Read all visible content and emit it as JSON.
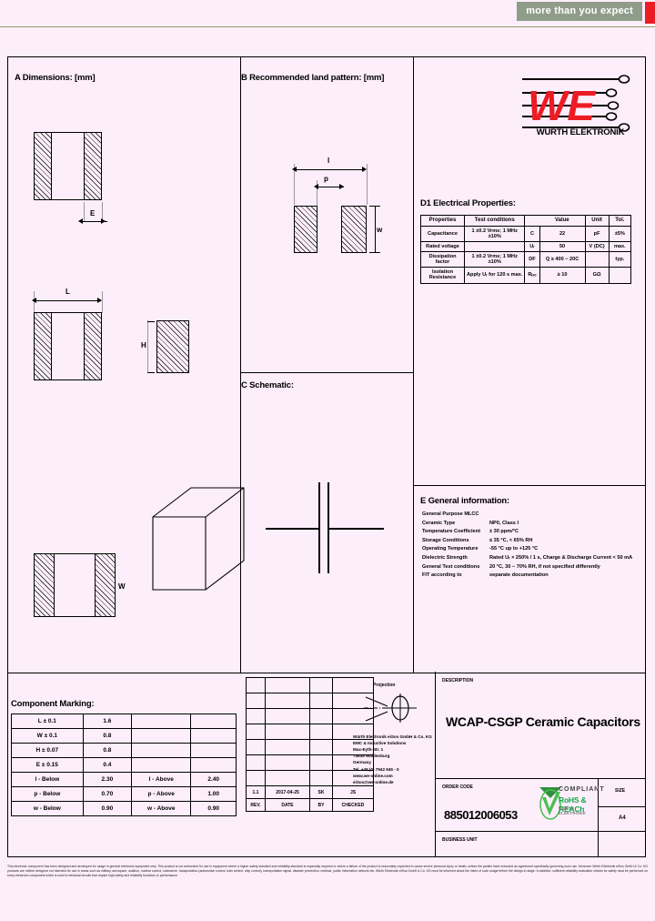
{
  "banner": {
    "tagline": "more than you expect"
  },
  "sections": {
    "a": "A Dimensions: [mm]",
    "b": "B Recommended land pattern: [mm]",
    "c": "C Schematic:",
    "d1": "D1  Electrical Properties:",
    "e": "E General information:",
    "marking": "Component Marking:"
  },
  "logo": {
    "brand": "WÜRTH ELEKTRONIK",
    "mark": "WE"
  },
  "dimension_labels": {
    "e": "E",
    "l": "L",
    "h": "H",
    "w": "W",
    "land_l": "l",
    "land_p": "p",
    "land_w": "w"
  },
  "electrical": {
    "headers": [
      "Properties",
      "Test conditions",
      "",
      "Value",
      "Unit",
      "Tol."
    ],
    "rows": [
      {
        "property": "Capacitance",
        "conditions": "1 ±0.2 Vrms; 1 MHz ±10%",
        "symbol": "C",
        "value": "22",
        "unit": "pF",
        "tol": "±5%"
      },
      {
        "property": "Rated voltage",
        "conditions": "",
        "symbol": "Uᵣ",
        "value": "50",
        "unit": "V (DC)",
        "tol": "max."
      },
      {
        "property": "Dissipation factor",
        "conditions": "1 ±0.2 Vrms; 1 MHz ±10%",
        "symbol": "DF",
        "value": "Q ≥ 400 − 20C",
        "unit": "",
        "tol": "typ."
      },
      {
        "property": "Isolation Resistance",
        "conditions": "Apply Uᵣ for 120 s max.",
        "symbol": "Rᵢₛₒ",
        "value": "≥ 10",
        "unit": "GΩ",
        "tol": ""
      }
    ]
  },
  "general_info": {
    "intro": "General Purpose MLCC",
    "rows": [
      {
        "key": "Ceramic Type",
        "value": "NP0, Class I"
      },
      {
        "key": "Temperature Coefficient",
        "value": "± 30 ppm/°C"
      },
      {
        "key": "Storage Conditions",
        "value": "≤ 35 °C, < 65% RH"
      },
      {
        "key": "Operating Temperature",
        "value": "-55 °C up to +125 °C"
      },
      {
        "key": "Dielectric Strength",
        "value": "Rated Uᵣ × 250% / 1 s, Charge & Discharge Current < 50 mA"
      },
      {
        "key": "General Test conditions",
        "value": "20 °C, 30 − 70% RH, if not specified differently"
      },
      {
        "key": "FIT according to",
        "value": "separate documentation"
      }
    ]
  },
  "marking_table": {
    "rows": [
      {
        "c1": "L ± 0.1",
        "c2": "1.6",
        "c3": "",
        "c4": ""
      },
      {
        "c1": "W ± 0.1",
        "c2": "0.8",
        "c3": "",
        "c4": ""
      },
      {
        "c1": "H ± 0.07",
        "c2": "0.8",
        "c3": "",
        "c4": ""
      },
      {
        "c1": "E ± 0.15",
        "c2": "0.4",
        "c3": "",
        "c4": ""
      },
      {
        "c1": "l - Below",
        "c2": "2.30",
        "c3": "l - Above",
        "c4": "2.40"
      },
      {
        "c1": "p - Below",
        "c2": "0.70",
        "c3": "p - Above",
        "c4": "1.00"
      },
      {
        "c1": "w - Below",
        "c2": "0.90",
        "c3": "w - Above",
        "c4": "0.90"
      }
    ]
  },
  "title_block": {
    "description_label": "DESCRIPTION",
    "description": "WCAP-CSGP Ceramic Capacitors",
    "order_code_label": "ORDER CODE",
    "order_code": "885012006053",
    "size_label": "SIZE",
    "size_value": "A4",
    "business_unit_label": "BUSINESS UNIT"
  },
  "rohs": {
    "line1": "COMPLIANT",
    "line2": "RoHS & REACh",
    "line3": "WÜRTH ELEKTRONIK"
  },
  "packaging_notes": [
    "Würth Elektronik eiSos GmbH & Co. KG",
    "EMC & Inductive Solutions",
    "Max-Eyth-Str. 1",
    "74638 Waldenburg",
    "Germany",
    "Tel. +49 (0) 7942 945 - 0",
    "www.we-online.com",
    "eiSos@we-online.de"
  ],
  "revision": {
    "headers": [
      "REV.",
      "DATE",
      "BY",
      "CHECKED"
    ],
    "row": [
      "1.1",
      "2017-04-25",
      "SK",
      "JS"
    ],
    "projection_label": "Projection"
  },
  "footer_text": "This electronic component has been designed and developed for usage in general electronic equipment only. This product is not authorized for use in equipment where a higher safety standard and reliability standard is especially required or where a failure of the product is reasonably expected to cause severe personal injury or death, unless the parties have executed an agreement specifically governing such use. Moreover Würth Elektronik eiSos GmbH & Co. KG products are neither designed nor intended for use in areas such as military, aerospace, aviation, nuclear control, submarine, transportation (automotive control, train control, ship control), transportation signal, disaster prevention, medical, public information network etc. Würth Elektronik eiSos GmbH & Co. KG must be informed about the intent of such usage before the design-in stage. In addition, sufficient reliability evaluation checks for safety must be performed on every electronic component which is used in electrical circuits that require high safety and reliability functions or performance."
}
